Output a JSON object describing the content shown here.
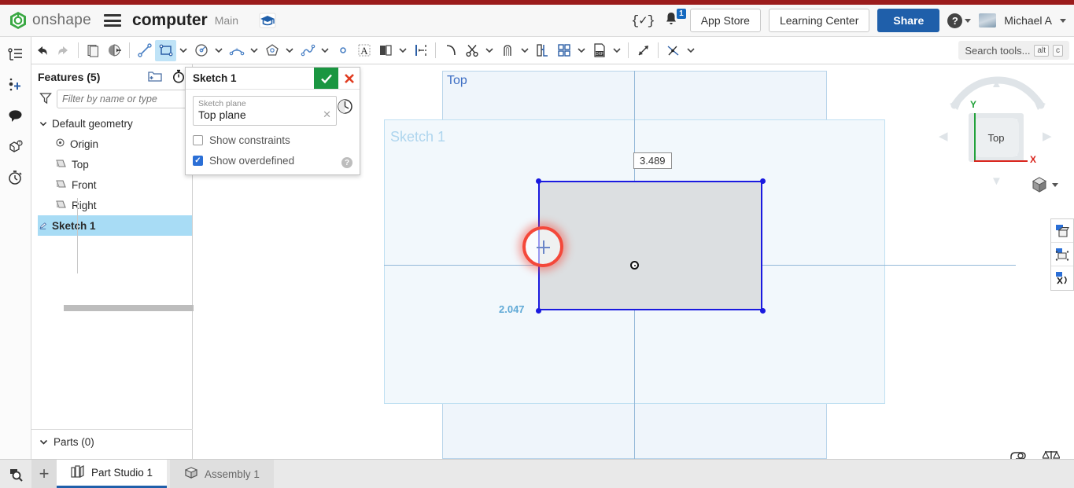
{
  "header": {
    "brand": "onshape",
    "document_title": "computer",
    "branch": "Main",
    "icons": {
      "logo": "onshape-logo-icon",
      "hamburger": "hamburger-menu-icon",
      "graduation": "learning-graduation-cap-icon",
      "fx": "{✓}",
      "bell": "notification-bell-icon"
    },
    "notification_count": "1",
    "app_store_label": "App Store",
    "learning_center_label": "Learning Center",
    "share_label": "Share",
    "user_name": "Michael A"
  },
  "toolbar": {
    "search_placeholder": "Search tools...",
    "shortcut_key1": "alt",
    "shortcut_key2": "c",
    "items": [
      {
        "name": "undo",
        "glyph": "undo-arrow-icon"
      },
      {
        "name": "redo",
        "glyph": "redo-arrow-icon"
      },
      {
        "name": "sketch",
        "glyph": "new-sketch-icon"
      },
      {
        "name": "sketch-shaded",
        "glyph": "sketch-shaded-icon"
      },
      {
        "name": "line",
        "glyph": "line-tool-icon"
      },
      {
        "name": "rectangle",
        "glyph": "rectangle-tool-icon"
      },
      {
        "name": "circle",
        "glyph": "circle-tool-icon"
      },
      {
        "name": "arc",
        "glyph": "arc-tool-icon"
      },
      {
        "name": "polygon",
        "glyph": "polygon-tool-icon"
      },
      {
        "name": "spline",
        "glyph": "spline-tool-icon"
      },
      {
        "name": "point",
        "glyph": "point-tool-icon"
      },
      {
        "name": "text",
        "glyph": "sketch-text-icon"
      },
      {
        "name": "mirror",
        "glyph": "mirror-tool-icon"
      },
      {
        "name": "dimension",
        "glyph": "dimension-tool-icon"
      },
      {
        "name": "fillet",
        "glyph": "fillet-tool-icon"
      },
      {
        "name": "trim",
        "glyph": "trim-scissors-icon"
      },
      {
        "name": "offset",
        "glyph": "offset-tool-icon"
      },
      {
        "name": "use-project",
        "glyph": "use-project-icon"
      },
      {
        "name": "linear-pattern",
        "glyph": "sketch-pattern-icon"
      },
      {
        "name": "import-dxf",
        "glyph": "import-dxf-icon"
      },
      {
        "name": "extend",
        "glyph": "extend-tool-icon"
      },
      {
        "name": "constraints",
        "glyph": "constraint-tool-icon"
      }
    ]
  },
  "rail": {
    "items": [
      {
        "name": "feature-list-icon"
      },
      {
        "name": "add-variable-icon"
      },
      {
        "name": "comments-icon"
      },
      {
        "name": "part-info-icon"
      },
      {
        "name": "history-icon"
      }
    ]
  },
  "features_panel": {
    "title": "Features (5)",
    "filter_placeholder": "Filter by name or type",
    "icons": {
      "new_folder": "new-folder-icon",
      "rollback_timer": "rollback-timer-icon",
      "filter": "filter-funnel-icon"
    },
    "tree": [
      {
        "label": "Default geometry",
        "icon": "chevron-down-icon",
        "level": 0,
        "selected": false
      },
      {
        "label": "Origin",
        "icon": "origin-icon",
        "level": 1,
        "selected": false
      },
      {
        "label": "Top",
        "icon": "plane-icon",
        "level": 1,
        "selected": false
      },
      {
        "label": "Front",
        "icon": "plane-icon",
        "level": 1,
        "selected": false
      },
      {
        "label": "Right",
        "icon": "plane-icon",
        "level": 1,
        "selected": false
      },
      {
        "label": "Sketch 1",
        "icon": "sketch-icon",
        "level": 0,
        "selected": true
      }
    ],
    "parts_label": "Parts (0)"
  },
  "sketch_dialog": {
    "title": "Sketch 1",
    "ok_glyph": "check-icon",
    "cancel_glyph": "close-x-icon",
    "plane_field_label": "Sketch plane",
    "plane_field_value": "Top plane",
    "clear_glyph": "clear-x-icon",
    "clock_icon": "sketch-plane-clock-icon",
    "show_constraints_label": "Show constraints",
    "show_constraints_checked": false,
    "show_overdefined_label": "Show overdefined",
    "show_overdefined_checked": true,
    "help_glyph": "?"
  },
  "canvas": {
    "plane_label": "Top",
    "sketch_label": "Sketch 1",
    "dimension_width": "3.489",
    "dimension_height": "2.047",
    "origin_marker": "origin-point",
    "cursor_marker": "crosshair-cursor"
  },
  "view_cube": {
    "face_label": "Top",
    "axis_y": "Y",
    "axis_x": "X",
    "view_menu_icon": "view-cube-dropdown-icon"
  },
  "right_strip": {
    "items": [
      {
        "name": "display-state-icon"
      },
      {
        "name": "section-view-icon"
      },
      {
        "name": "render-options-icon"
      }
    ]
  },
  "bottom_right": {
    "measure_icon": "measure-tape-icon",
    "mass_icon": "mass-properties-icon"
  },
  "tab_bar": {
    "search_icon": "tab-search-icon",
    "plus_label": "+",
    "tabs": [
      {
        "label": "Part Studio 1",
        "icon": "part-studio-icon",
        "active": true
      },
      {
        "label": "Assembly 1",
        "icon": "assembly-icon",
        "active": false
      }
    ]
  },
  "colors": {
    "brand_red": "#9b1c1c",
    "share_blue": "#1f5faa",
    "ok_green": "#1a9641",
    "cancel_red": "#e03b20",
    "sketch_blue": "#1a1ae0",
    "cursor_red": "#f4483a",
    "selection_blue": "#a8dcf5"
  }
}
